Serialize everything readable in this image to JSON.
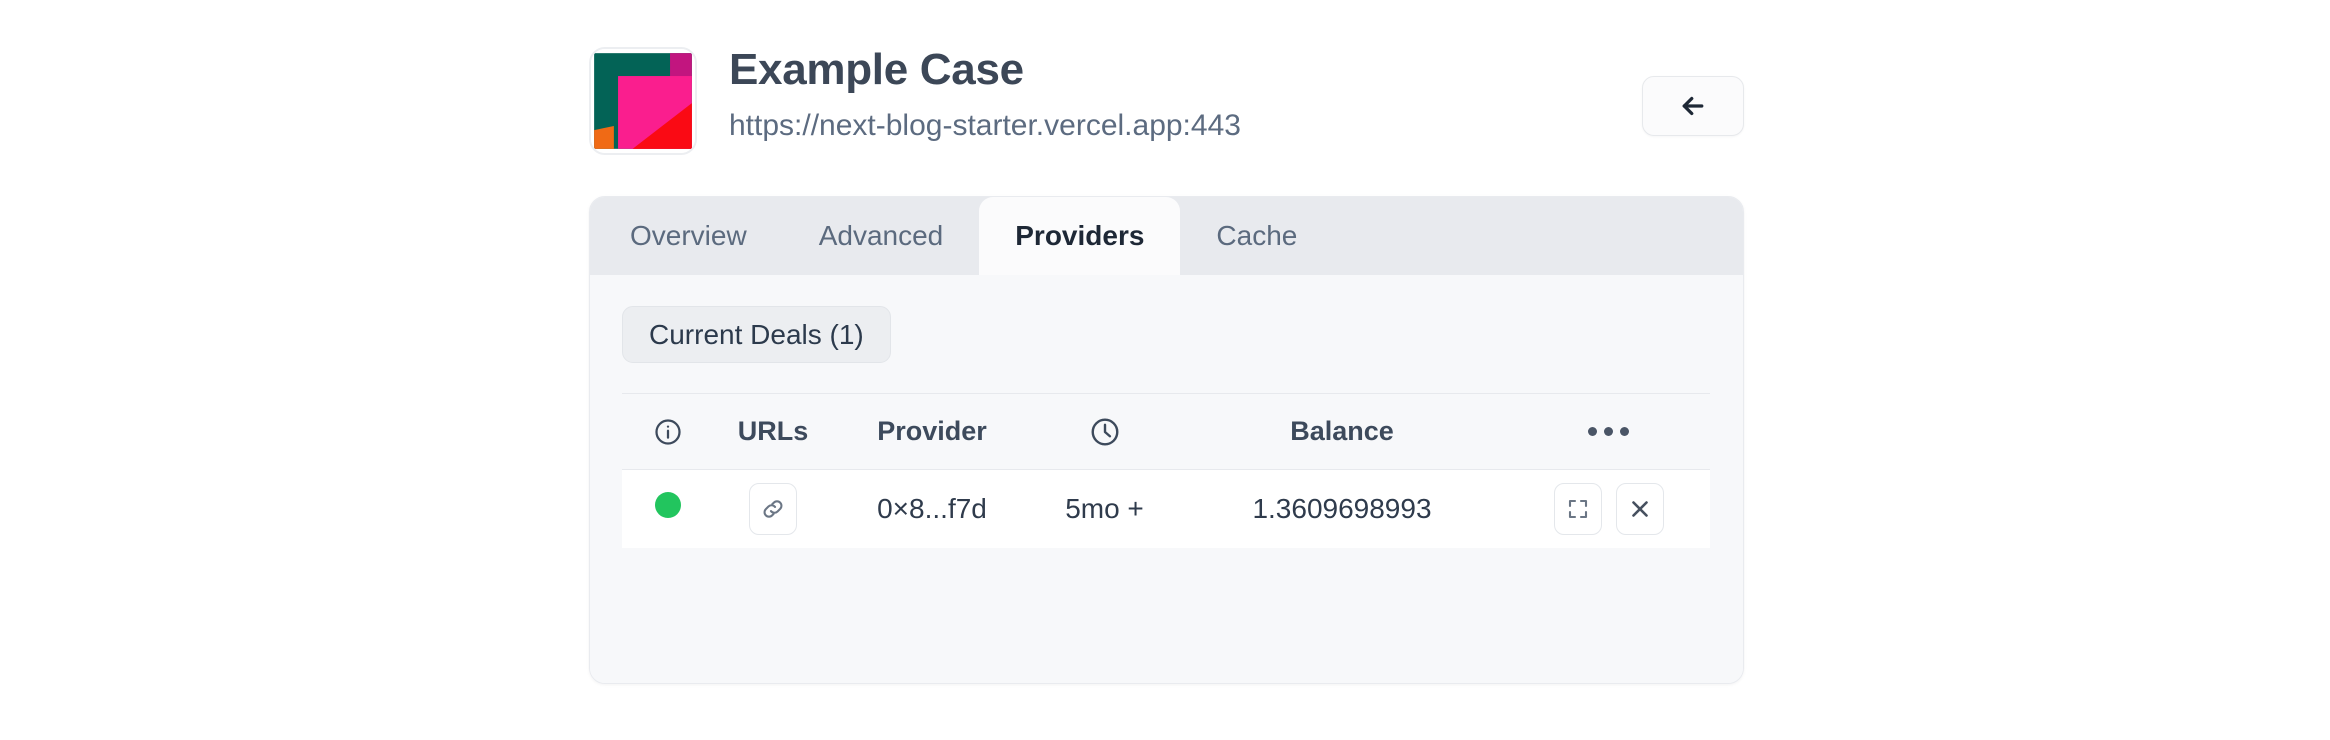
{
  "header": {
    "logo_icon": "site-favicon-abstract-blocks",
    "title": "Example Case",
    "url": "https://next-blog-starter.vercel.app:443",
    "back_button": {
      "icon": "arrow-left-icon",
      "label": ""
    }
  },
  "tabs": [
    {
      "label": "Overview",
      "active": false
    },
    {
      "label": "Advanced",
      "active": false
    },
    {
      "label": "Providers",
      "active": true
    },
    {
      "label": "Cache",
      "active": false
    }
  ],
  "toolbar": {
    "current_deals_label": "Current Deals (1)"
  },
  "table": {
    "columns": [
      {
        "key": "status",
        "label": "",
        "icon": "info-circle-icon"
      },
      {
        "key": "urls",
        "label": "URLs",
        "icon": ""
      },
      {
        "key": "provider",
        "label": "Provider",
        "icon": ""
      },
      {
        "key": "time",
        "label": "",
        "icon": "clock-icon"
      },
      {
        "key": "balance",
        "label": "Balance",
        "icon": ""
      },
      {
        "key": "actions",
        "label": "",
        "icon": "ellipsis-horizontal-icon"
      }
    ],
    "rows": [
      {
        "status": "online",
        "status_color": "#22c55e",
        "urls_icon": "link-icon",
        "provider": "0×8...f7d",
        "time": "5mo +",
        "balance": "1.3609698993",
        "actions": [
          {
            "icon": "maximize-icon"
          },
          {
            "icon": "close-x-icon"
          }
        ]
      }
    ]
  },
  "colors": {
    "accent_green": "#22c55e",
    "card_bg": "#f7f8fa",
    "tabstrip_bg": "#e8eaee",
    "active_tab_bg": "#fbfbfc",
    "text_dark": "#3c4757",
    "text_muted": "#5c6b80",
    "border": "#e9ebef"
  }
}
